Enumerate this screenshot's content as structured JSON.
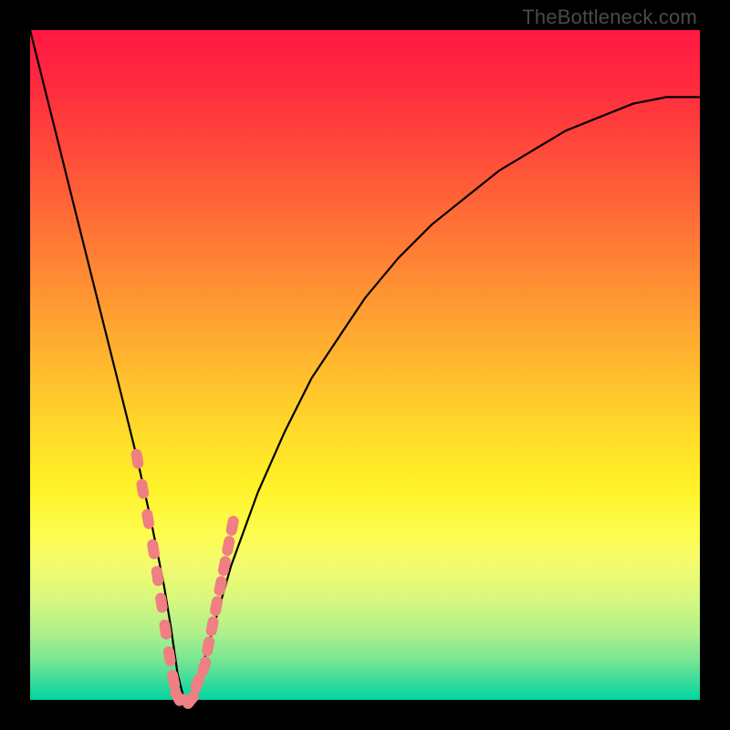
{
  "watermark": "TheBottleneck.com",
  "chart_data": {
    "type": "line",
    "title": "",
    "xlabel": "",
    "ylabel": "",
    "xlim": [
      0,
      100
    ],
    "ylim": [
      0,
      100
    ],
    "series": [
      {
        "name": "curve",
        "color": "#000000",
        "x": [
          0,
          2,
          4,
          6,
          8,
          10,
          12,
          14,
          16,
          18,
          19,
          20,
          21,
          22,
          23,
          24,
          26,
          28,
          30,
          34,
          38,
          42,
          46,
          50,
          55,
          60,
          65,
          70,
          75,
          80,
          85,
          90,
          95,
          100
        ],
        "y": [
          100,
          92,
          84,
          76,
          68,
          60,
          52,
          44,
          36,
          27,
          22,
          17,
          11,
          4,
          0,
          0,
          6,
          13,
          20,
          31,
          40,
          48,
          54,
          60,
          66,
          71,
          75,
          79,
          82,
          85,
          87,
          89,
          90,
          90
        ]
      },
      {
        "name": "markers",
        "color": "#ef7f82",
        "type": "scatter",
        "x": [
          16.0,
          16.8,
          17.6,
          18.4,
          19.0,
          19.6,
          20.2,
          20.8,
          21.4,
          22.0,
          23.0,
          24.0,
          25.0,
          26.0,
          26.6,
          27.2,
          27.8,
          28.4,
          29.0,
          29.6,
          30.2
        ],
        "y": [
          36.0,
          31.5,
          27.0,
          22.5,
          18.5,
          14.5,
          10.5,
          6.5,
          3.0,
          0.5,
          0.0,
          0.0,
          2.5,
          5.0,
          8.0,
          11.0,
          14.0,
          17.0,
          20.0,
          23.0,
          26.0
        ]
      }
    ],
    "gradient_stops": [
      {
        "pos": 0.0,
        "color": "#ff1842"
      },
      {
        "pos": 0.5,
        "color": "#ffd42b"
      },
      {
        "pos": 0.75,
        "color": "#fdfd4e"
      },
      {
        "pos": 1.0,
        "color": "#00d4a0"
      }
    ]
  }
}
